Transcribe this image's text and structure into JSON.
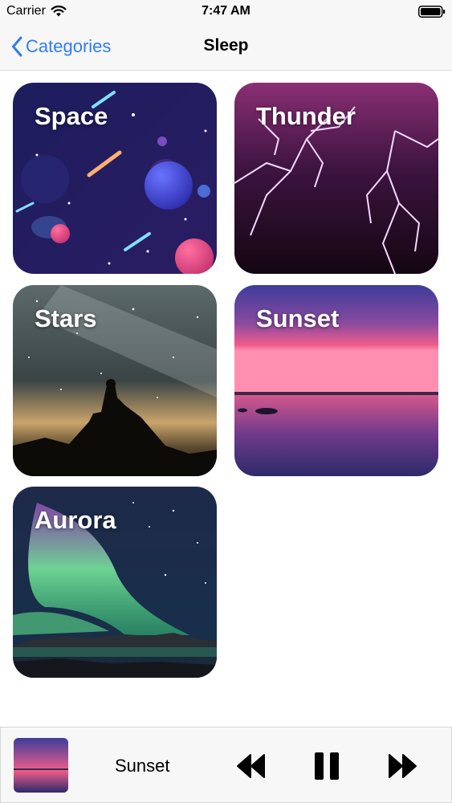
{
  "status_bar": {
    "carrier": "Carrier",
    "time": "7:47 AM"
  },
  "nav": {
    "back_label": "Categories",
    "title": "Sleep"
  },
  "categories": [
    {
      "label": "Space"
    },
    {
      "label": "Thunder"
    },
    {
      "label": "Stars"
    },
    {
      "label": "Sunset"
    },
    {
      "label": "Aurora"
    }
  ],
  "player": {
    "track_title": "Sunset"
  },
  "colors": {
    "accent": "#2f7cf6",
    "bar_background": "#f7f7f7"
  }
}
